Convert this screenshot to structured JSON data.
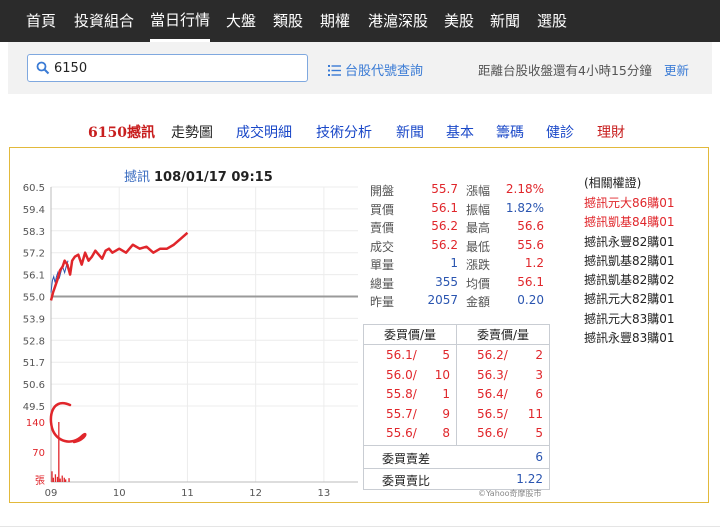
{
  "nav": {
    "items": [
      "首頁",
      "投資組合",
      "當日行情",
      "大盤",
      "類股",
      "期權",
      "港滬深股",
      "美股",
      "新聞",
      "選股"
    ],
    "active_index": 2
  },
  "search": {
    "value": "6150",
    "placeholder": ""
  },
  "code_lookup_label": "台股代號查詢",
  "close_info": "距離台股收盤還有4小時15分鐘",
  "refresh_label": "更新",
  "subnav": {
    "stock": "6150撼訊",
    "items": [
      "走勢圖",
      "成交明細",
      "技術分析",
      "新聞",
      "基本",
      "籌碼",
      "健診",
      "理財"
    ]
  },
  "chart": {
    "name": "撼訊",
    "datetime": "108/01/17 09:15"
  },
  "chart_data": {
    "type": "line",
    "title": "撼訊 108/01/17 09:15",
    "x_ticks": [
      "09",
      "10",
      "11",
      "12",
      "13"
    ],
    "x_range": [
      9.0,
      13.5
    ],
    "y_ticks": [
      "60.5",
      "59.4",
      "58.3",
      "57.2",
      "56.1",
      "55.0",
      "53.9",
      "52.8",
      "51.7",
      "50.6",
      "49.5"
    ],
    "ylim": [
      49.5,
      60.5
    ],
    "reference_price": 55.0,
    "series": [
      {
        "x": [
          9.0,
          9.02,
          9.04,
          9.06,
          9.08,
          9.1,
          9.12,
          9.15,
          9.17,
          9.2,
          9.23,
          9.25
        ],
        "y": [
          55.2,
          55.8,
          56.0,
          55.7,
          56.0,
          56.2,
          55.9,
          56.3,
          56.5,
          56.2,
          56.6,
          56.8
        ]
      }
    ],
    "volume": {
      "y_ticks": [
        "140",
        "70",
        "張"
      ],
      "x": [
        9.0,
        9.02,
        9.05,
        9.08,
        9.1,
        9.12,
        9.15,
        9.18,
        9.2,
        9.25
      ],
      "values": [
        25,
        10,
        18,
        12,
        140,
        8,
        15,
        10,
        6,
        9
      ]
    },
    "annotation_line": {
      "x": [
        9.0,
        9.03,
        9.06,
        9.1,
        9.13,
        9.17,
        9.2,
        9.24,
        9.28,
        9.31,
        9.35,
        9.4,
        9.45,
        9.5,
        9.55,
        9.6,
        9.65,
        9.7,
        9.75,
        9.8,
        9.85,
        9.9,
        10.0,
        10.1,
        10.2,
        10.3,
        10.4,
        10.5,
        10.6,
        10.7,
        10.8,
        10.9,
        11.0
      ],
      "y": [
        54.8,
        55.2,
        55.5,
        55.9,
        56.3,
        56.5,
        56.8,
        56.6,
        56.1,
        56.8,
        57.0,
        57.1,
        56.6,
        57.2,
        56.8,
        57.0,
        57.3,
        57.1,
        56.9,
        57.3,
        57.4,
        57.2,
        57.4,
        57.2,
        57.6,
        57.4,
        57.5,
        57.2,
        57.4,
        57.4,
        57.6,
        57.9,
        58.2
      ]
    }
  },
  "quote": {
    "rows": [
      {
        "l1": "開盤",
        "v1": "55.7",
        "l2": "漲幅",
        "v2": "2.18%",
        "c1": "red",
        "c2": "red"
      },
      {
        "l1": "買價",
        "v1": "56.1",
        "l2": "振幅",
        "v2": "1.82%",
        "c1": "red",
        "c2": "blue"
      },
      {
        "l1": "賣價",
        "v1": "56.2",
        "l2": "最高",
        "v2": "56.6",
        "c1": "red",
        "c2": "red"
      },
      {
        "l1": "成交",
        "v1": "56.2",
        "l2": "最低",
        "v2": "55.6",
        "c1": "red",
        "c2": "red"
      },
      {
        "l1": "單量",
        "v1": "1",
        "l2": "漲跌",
        "v2": "1.2",
        "c1": "blue",
        "c2": "red"
      },
      {
        "l1": "總量",
        "v1": "355",
        "l2": "均價",
        "v2": "56.1",
        "c1": "blue",
        "c2": "red"
      },
      {
        "l1": "昨量",
        "v1": "2057",
        "l2": "金額",
        "v2": "0.20",
        "c1": "blue",
        "c2": "blue"
      }
    ]
  },
  "order_book": {
    "bid_header": "委買價/量",
    "ask_header": "委賣價/量",
    "rows": [
      {
        "bp": "56.1/",
        "bv": "5",
        "ap": "56.2/",
        "av": "2"
      },
      {
        "bp": "56.0/",
        "bv": "10",
        "ap": "56.3/",
        "av": "3"
      },
      {
        "bp": "55.8/",
        "bv": "1",
        "ap": "56.4/",
        "av": "6"
      },
      {
        "bp": "55.7/",
        "bv": "9",
        "ap": "56.5/",
        "av": "11"
      },
      {
        "bp": "55.6/",
        "bv": "8",
        "ap": "56.6/",
        "av": "5"
      }
    ],
    "diff_label": "委買賣差",
    "diff_value": "6",
    "ratio_label": "委買賣比",
    "ratio_value": "1.22"
  },
  "related": {
    "header": "(相關權證)",
    "items": [
      {
        "name": "撼訊元大86購01",
        "color": "red"
      },
      {
        "name": "撼訊凱基84購01",
        "color": "red"
      },
      {
        "name": "撼訊永豐82購01",
        "color": "dark"
      },
      {
        "name": "撼訊凱基82購01",
        "color": "dark"
      },
      {
        "name": "撼訊凱基82購02",
        "color": "dark"
      },
      {
        "name": "撼訊元大82購01",
        "color": "dark"
      },
      {
        "name": "撼訊元大83購01",
        "color": "dark"
      },
      {
        "name": "撼訊永豐83購01",
        "color": "dark"
      }
    ]
  },
  "copyright": "©Yahoo奇摩股市",
  "colors": {
    "up": "#e0262b",
    "down": "#2a55b0",
    "accent": "#3a7bd5",
    "panel_border": "#e2b93b",
    "annotation": "#e0262b"
  }
}
